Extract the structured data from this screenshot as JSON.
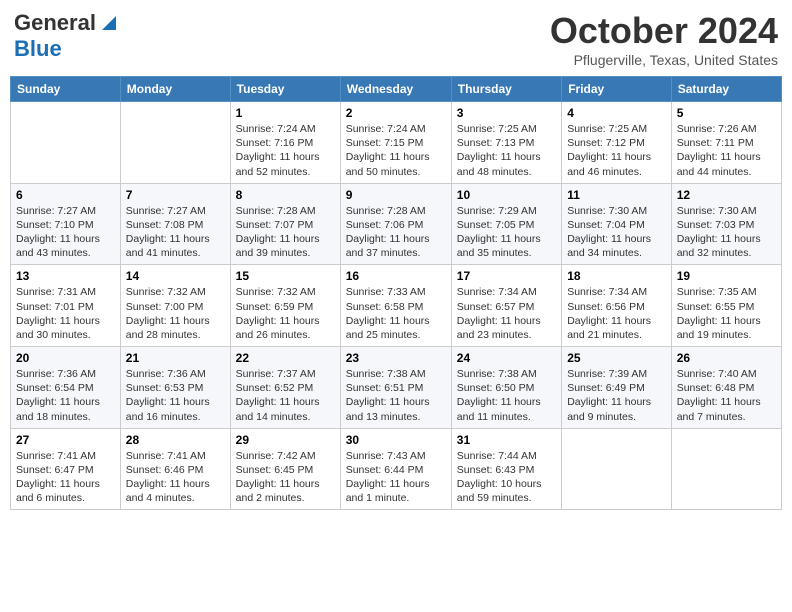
{
  "header": {
    "logo_line1": "General",
    "logo_line2": "Blue",
    "month": "October 2024",
    "location": "Pflugerville, Texas, United States"
  },
  "days_of_week": [
    "Sunday",
    "Monday",
    "Tuesday",
    "Wednesday",
    "Thursday",
    "Friday",
    "Saturday"
  ],
  "weeks": [
    [
      {
        "day": "",
        "info": ""
      },
      {
        "day": "",
        "info": ""
      },
      {
        "day": "1",
        "info": "Sunrise: 7:24 AM\nSunset: 7:16 PM\nDaylight: 11 hours and 52 minutes."
      },
      {
        "day": "2",
        "info": "Sunrise: 7:24 AM\nSunset: 7:15 PM\nDaylight: 11 hours and 50 minutes."
      },
      {
        "day": "3",
        "info": "Sunrise: 7:25 AM\nSunset: 7:13 PM\nDaylight: 11 hours and 48 minutes."
      },
      {
        "day": "4",
        "info": "Sunrise: 7:25 AM\nSunset: 7:12 PM\nDaylight: 11 hours and 46 minutes."
      },
      {
        "day": "5",
        "info": "Sunrise: 7:26 AM\nSunset: 7:11 PM\nDaylight: 11 hours and 44 minutes."
      }
    ],
    [
      {
        "day": "6",
        "info": "Sunrise: 7:27 AM\nSunset: 7:10 PM\nDaylight: 11 hours and 43 minutes."
      },
      {
        "day": "7",
        "info": "Sunrise: 7:27 AM\nSunset: 7:08 PM\nDaylight: 11 hours and 41 minutes."
      },
      {
        "day": "8",
        "info": "Sunrise: 7:28 AM\nSunset: 7:07 PM\nDaylight: 11 hours and 39 minutes."
      },
      {
        "day": "9",
        "info": "Sunrise: 7:28 AM\nSunset: 7:06 PM\nDaylight: 11 hours and 37 minutes."
      },
      {
        "day": "10",
        "info": "Sunrise: 7:29 AM\nSunset: 7:05 PM\nDaylight: 11 hours and 35 minutes."
      },
      {
        "day": "11",
        "info": "Sunrise: 7:30 AM\nSunset: 7:04 PM\nDaylight: 11 hours and 34 minutes."
      },
      {
        "day": "12",
        "info": "Sunrise: 7:30 AM\nSunset: 7:03 PM\nDaylight: 11 hours and 32 minutes."
      }
    ],
    [
      {
        "day": "13",
        "info": "Sunrise: 7:31 AM\nSunset: 7:01 PM\nDaylight: 11 hours and 30 minutes."
      },
      {
        "day": "14",
        "info": "Sunrise: 7:32 AM\nSunset: 7:00 PM\nDaylight: 11 hours and 28 minutes."
      },
      {
        "day": "15",
        "info": "Sunrise: 7:32 AM\nSunset: 6:59 PM\nDaylight: 11 hours and 26 minutes."
      },
      {
        "day": "16",
        "info": "Sunrise: 7:33 AM\nSunset: 6:58 PM\nDaylight: 11 hours and 25 minutes."
      },
      {
        "day": "17",
        "info": "Sunrise: 7:34 AM\nSunset: 6:57 PM\nDaylight: 11 hours and 23 minutes."
      },
      {
        "day": "18",
        "info": "Sunrise: 7:34 AM\nSunset: 6:56 PM\nDaylight: 11 hours and 21 minutes."
      },
      {
        "day": "19",
        "info": "Sunrise: 7:35 AM\nSunset: 6:55 PM\nDaylight: 11 hours and 19 minutes."
      }
    ],
    [
      {
        "day": "20",
        "info": "Sunrise: 7:36 AM\nSunset: 6:54 PM\nDaylight: 11 hours and 18 minutes."
      },
      {
        "day": "21",
        "info": "Sunrise: 7:36 AM\nSunset: 6:53 PM\nDaylight: 11 hours and 16 minutes."
      },
      {
        "day": "22",
        "info": "Sunrise: 7:37 AM\nSunset: 6:52 PM\nDaylight: 11 hours and 14 minutes."
      },
      {
        "day": "23",
        "info": "Sunrise: 7:38 AM\nSunset: 6:51 PM\nDaylight: 11 hours and 13 minutes."
      },
      {
        "day": "24",
        "info": "Sunrise: 7:38 AM\nSunset: 6:50 PM\nDaylight: 11 hours and 11 minutes."
      },
      {
        "day": "25",
        "info": "Sunrise: 7:39 AM\nSunset: 6:49 PM\nDaylight: 11 hours and 9 minutes."
      },
      {
        "day": "26",
        "info": "Sunrise: 7:40 AM\nSunset: 6:48 PM\nDaylight: 11 hours and 7 minutes."
      }
    ],
    [
      {
        "day": "27",
        "info": "Sunrise: 7:41 AM\nSunset: 6:47 PM\nDaylight: 11 hours and 6 minutes."
      },
      {
        "day": "28",
        "info": "Sunrise: 7:41 AM\nSunset: 6:46 PM\nDaylight: 11 hours and 4 minutes."
      },
      {
        "day": "29",
        "info": "Sunrise: 7:42 AM\nSunset: 6:45 PM\nDaylight: 11 hours and 2 minutes."
      },
      {
        "day": "30",
        "info": "Sunrise: 7:43 AM\nSunset: 6:44 PM\nDaylight: 11 hours and 1 minute."
      },
      {
        "day": "31",
        "info": "Sunrise: 7:44 AM\nSunset: 6:43 PM\nDaylight: 10 hours and 59 minutes."
      },
      {
        "day": "",
        "info": ""
      },
      {
        "day": "",
        "info": ""
      }
    ]
  ]
}
